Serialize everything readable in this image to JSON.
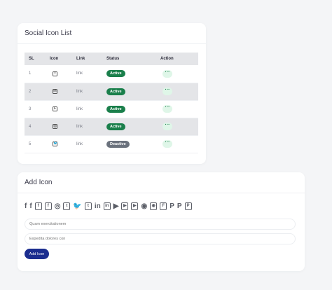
{
  "list_card": {
    "title": "Social Icon List",
    "columns": [
      "SL",
      "Icon",
      "Link",
      "Status",
      "Action"
    ],
    "rows": [
      {
        "sl": "1",
        "icon": "facebook-square-icon",
        "glyph": "f",
        "link": "link",
        "status": "Active",
        "action": "···"
      },
      {
        "sl": "2",
        "icon": "linkedin-square-icon",
        "glyph": "in",
        "link": "link",
        "status": "Active",
        "action": "···"
      },
      {
        "sl": "3",
        "icon": "foursquare-icon",
        "glyph": "F",
        "link": "link",
        "status": "Active",
        "action": "···"
      },
      {
        "sl": "4",
        "icon": "instagram-icon",
        "glyph": "◎",
        "link": "link",
        "status": "Active",
        "action": "···"
      },
      {
        "sl": "5",
        "icon": "twitter-icon",
        "glyph": "🐦",
        "link": "link",
        "status": "Deactive",
        "action": "···"
      }
    ]
  },
  "add_card": {
    "title": "Add Icon",
    "icons": [
      {
        "name": "facebook-f-icon",
        "glyph": "f",
        "boxed": false
      },
      {
        "name": "facebook-icon",
        "glyph": "f",
        "boxed": false
      },
      {
        "name": "facebook-square-icon",
        "glyph": "f",
        "boxed": true
      },
      {
        "name": "facebook-square-alt-icon",
        "glyph": "f",
        "boxed": true
      },
      {
        "name": "instagram-icon",
        "glyph": "◎",
        "boxed": false
      },
      {
        "name": "twitch-icon",
        "glyph": "t",
        "boxed": true
      },
      {
        "name": "twitter-icon",
        "glyph": "🐦",
        "boxed": false
      },
      {
        "name": "twitter-square-icon",
        "glyph": "t",
        "boxed": true
      },
      {
        "name": "linkedin-icon",
        "glyph": "in",
        "boxed": false
      },
      {
        "name": "linkedin-square-icon",
        "glyph": "in",
        "boxed": true
      },
      {
        "name": "youtube-icon",
        "glyph": "▶",
        "boxed": false
      },
      {
        "name": "youtube-play-icon",
        "glyph": "▶",
        "boxed": true
      },
      {
        "name": "youtube-square-icon",
        "glyph": "▶",
        "boxed": true
      },
      {
        "name": "github-icon",
        "glyph": "◉",
        "boxed": false
      },
      {
        "name": "github-square-icon",
        "glyph": "◉",
        "boxed": true
      },
      {
        "name": "foursquare-icon",
        "glyph": "F",
        "boxed": true
      },
      {
        "name": "pinterest-icon",
        "glyph": "P",
        "boxed": false
      },
      {
        "name": "pinterest-p-icon",
        "glyph": "P",
        "boxed": false
      },
      {
        "name": "pinterest-square-icon",
        "glyph": "P",
        "boxed": true
      }
    ],
    "field1_placeholder": "Quam exercitationem",
    "field2_placeholder": "Expedita dolores con",
    "button_label": "Add Icon"
  }
}
